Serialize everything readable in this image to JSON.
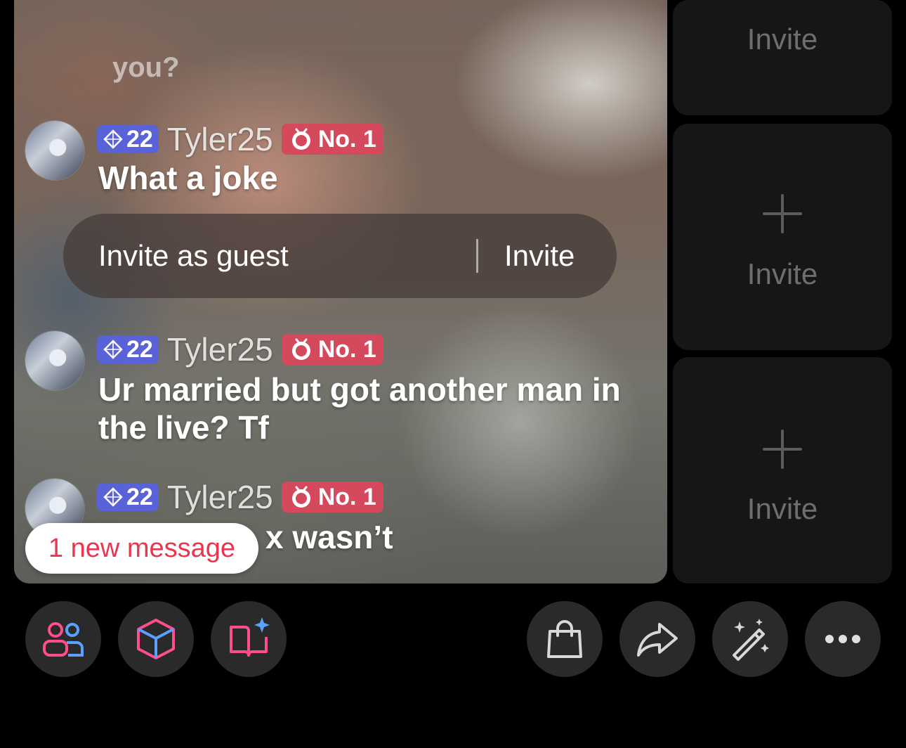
{
  "stream": {
    "previous_comment_tail": "you?",
    "comments": [
      {
        "level": "22",
        "username": "Tyler25",
        "rank": "No. 1",
        "text": "What a joke"
      },
      {
        "level": "22",
        "username": "Tyler25",
        "rank": "No. 1",
        "text": "Ur married but got another man in the live? Tf"
      },
      {
        "level": "22",
        "username": "Tyler25",
        "rank": "No. 1",
        "text": "x wasn’t"
      }
    ],
    "invite_prompt": {
      "label": "Invite as guest",
      "button": "Invite"
    },
    "new_message_chip": "1 new message"
  },
  "guest_slots": [
    {
      "label": "Invite"
    },
    {
      "label": "Invite"
    },
    {
      "label": "Invite"
    }
  ],
  "toolbar": {
    "left": [
      "people-icon",
      "cube-icon",
      "book-sparkle-icon"
    ],
    "right": [
      "shopping-bag-icon",
      "share-arrow-icon",
      "magic-wand-icon",
      "more-dots-icon"
    ]
  },
  "colors": {
    "level_badge": "#5a62d8",
    "rank_badge": "#d44a5c",
    "new_message_text": "#e8374e",
    "slot_bg": "#161616",
    "toolbar_button_bg": "#2a2a2a"
  }
}
